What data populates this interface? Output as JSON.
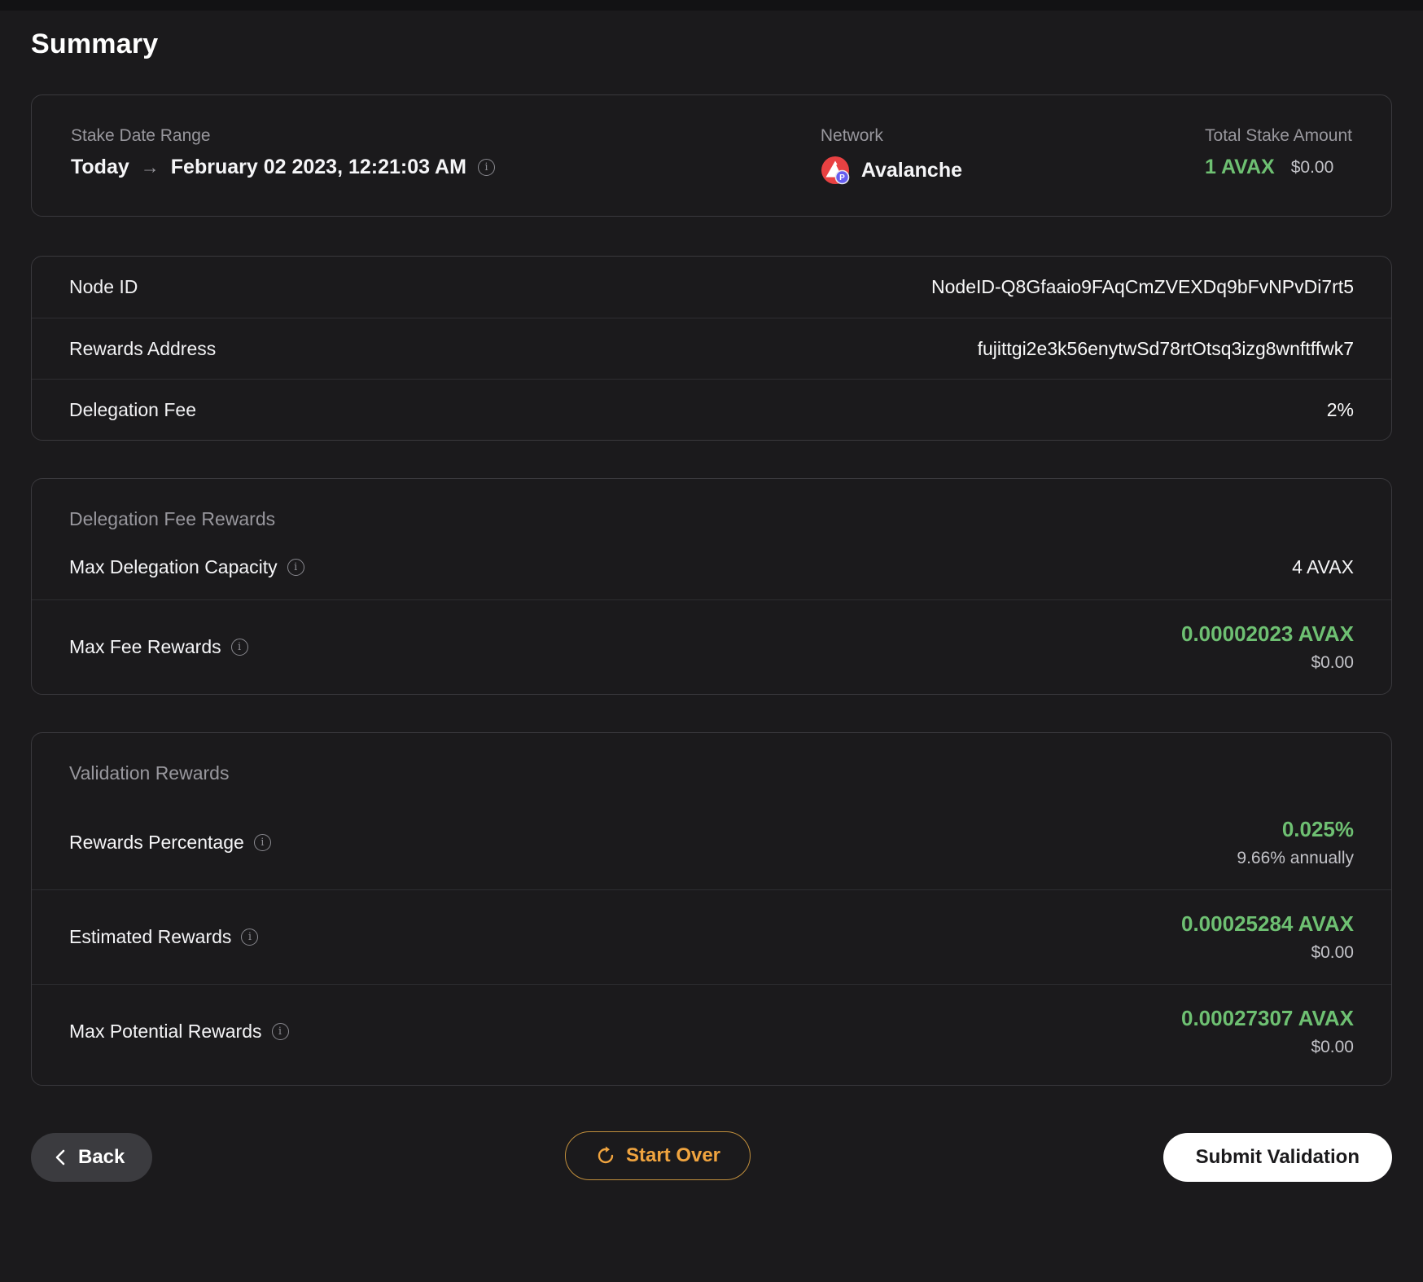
{
  "page": {
    "title": "Summary"
  },
  "summary_card": {
    "stake_date_range": {
      "label": "Stake Date Range",
      "from": "Today",
      "arrow": "→",
      "to": "February 02 2023, 12:21:03 AM"
    },
    "network": {
      "label": "Network",
      "value": "Avalanche",
      "badge_letter": "P"
    },
    "total_stake": {
      "label": "Total Stake Amount",
      "amount": "1 AVAX",
      "fiat": "$0.00"
    }
  },
  "details_card": {
    "rows": [
      {
        "label": "Node ID",
        "value": "NodeID-Q8Gfaaio9FAqCmZVEXDq9bFvNPvDi7rt5"
      },
      {
        "label": "Rewards Address",
        "value": "fujittgi2e3k56enytwSd78rtOtsq3izg8wnftffwk7"
      },
      {
        "label": "Delegation Fee",
        "value": "2%"
      }
    ]
  },
  "delegation_card": {
    "title": "Delegation Fee Rewards",
    "capacity_row": {
      "label": "Max Delegation Capacity",
      "value": "4 AVAX"
    },
    "fee_row": {
      "label": "Max Fee Rewards",
      "value": "0.00002023 AVAX",
      "fiat": "$0.00"
    }
  },
  "validation_card": {
    "title": "Validation Rewards",
    "rows": [
      {
        "label": "Rewards Percentage",
        "value": "0.025%",
        "sub": "9.66% annually"
      },
      {
        "label": "Estimated Rewards",
        "value": "0.00025284 AVAX",
        "sub": "$0.00"
      },
      {
        "label": "Max Potential Rewards",
        "value": "0.00027307 AVAX",
        "sub": "$0.00"
      }
    ]
  },
  "footer": {
    "back_label": "Back",
    "start_over_label": "Start Over",
    "submit_label": "Submit Validation"
  },
  "colors": {
    "accent_green": "#6ec072",
    "accent_orange": "#f0a43f",
    "avalanche_red": "#e84142",
    "badge_purple": "#655df0"
  }
}
